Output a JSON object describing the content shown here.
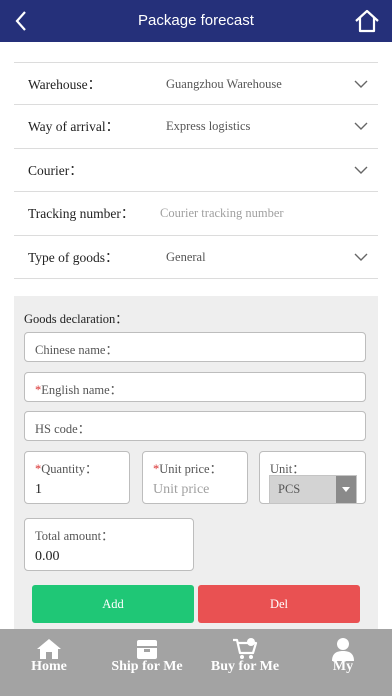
{
  "header": {
    "title": "Package forecast",
    "back_icon": "chevron-left-icon",
    "home_icon": "home-outline-icon",
    "background": "#25307a"
  },
  "form": {
    "warehouse": {
      "label": "Warehouse：",
      "value": "Guangzhou Warehouse"
    },
    "arrival": {
      "label": "Way of arrival：",
      "value": "Express logistics"
    },
    "courier": {
      "label": "Courier：",
      "value": ""
    },
    "tracking": {
      "label": "Tracking number：",
      "placeholder": "Courier tracking number"
    },
    "goods_type": {
      "label": "Type of goods：",
      "value": "General"
    }
  },
  "declaration": {
    "title": "Goods declaration：",
    "chinese_name": {
      "label": "Chinese name："
    },
    "english_name": {
      "required_mark": "*",
      "label": "English name："
    },
    "hs_code": {
      "label": "HS code："
    },
    "quantity": {
      "required_mark": "*",
      "label": "Quantity：",
      "value": "1"
    },
    "unit_price": {
      "required_mark": "*",
      "label": "Unit price：",
      "placeholder": "Unit price"
    },
    "unit": {
      "label": "Unit：",
      "value": "PCS"
    },
    "total_amount": {
      "label": "Total amount：",
      "value": "0.00"
    },
    "add_label": "Add",
    "del_label": "Del",
    "add_color": "#1fc776",
    "del_color": "#e95152"
  },
  "bottom_nav": {
    "items": [
      {
        "label": "Home",
        "icon": "home-icon"
      },
      {
        "label": "Ship for Me",
        "icon": "box-icon"
      },
      {
        "label": "Buy for Me",
        "icon": "cart-icon"
      },
      {
        "label": "My",
        "icon": "user-icon"
      }
    ]
  }
}
